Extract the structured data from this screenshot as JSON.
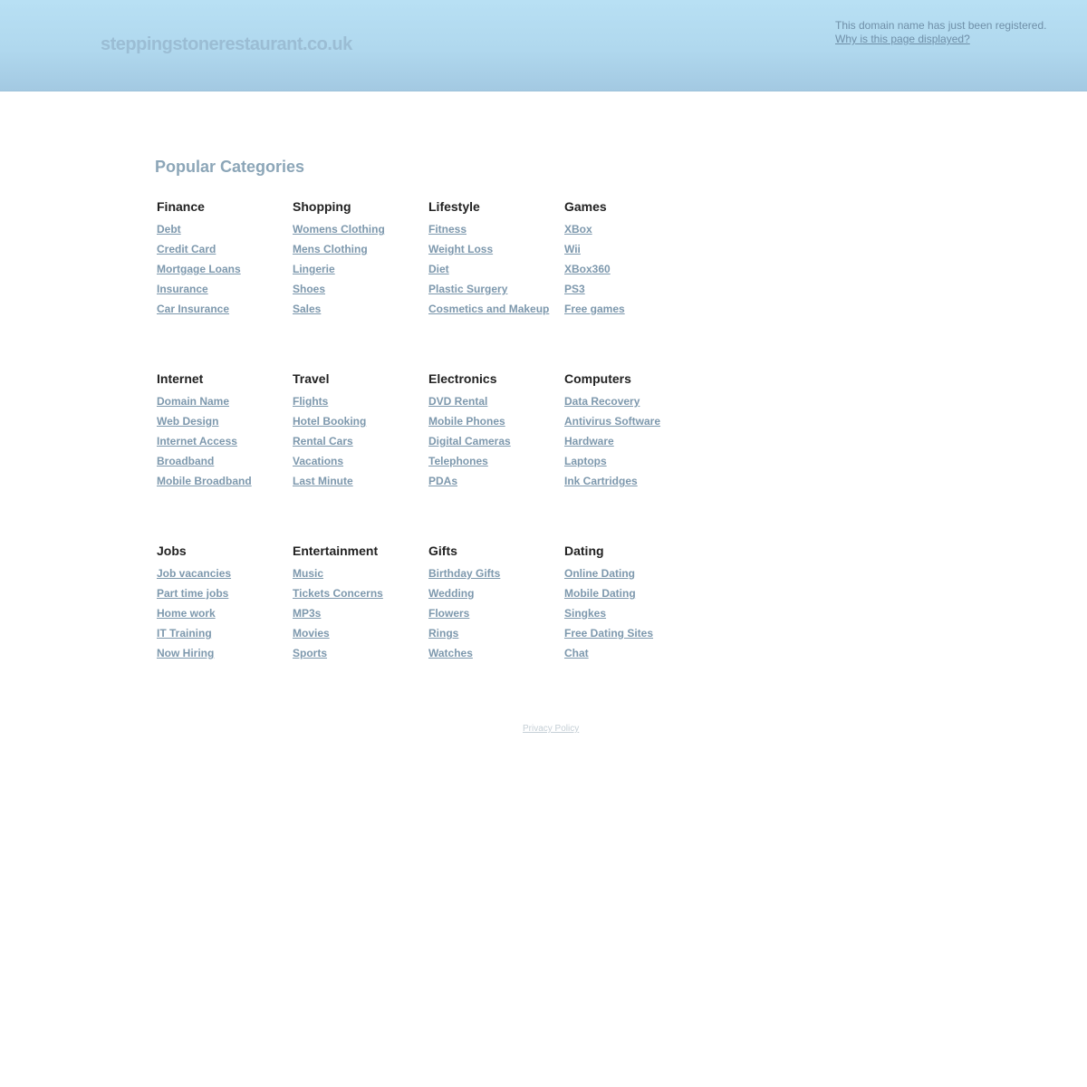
{
  "header": {
    "domain": "steppingstonerestaurant.co.uk",
    "notice": "This domain name has just been registered.",
    "why_link": "Why is this page displayed?"
  },
  "main": {
    "heading": "Popular Categories",
    "rows": [
      [
        {
          "title": "Finance",
          "links": [
            "Debt",
            "Credit Card",
            "Mortgage Loans",
            "Insurance",
            "Car Insurance"
          ]
        },
        {
          "title": "Shopping",
          "links": [
            "Womens Clothing",
            "Mens Clothing",
            "Lingerie",
            "Shoes",
            "Sales"
          ]
        },
        {
          "title": "Lifestyle",
          "links": [
            "Fitness",
            "Weight Loss",
            "Diet",
            "Plastic Surgery",
            "Cosmetics and Makeup"
          ]
        },
        {
          "title": "Games",
          "links": [
            "XBox",
            "Wii",
            "XBox360",
            "PS3",
            "Free games"
          ]
        }
      ],
      [
        {
          "title": "Internet",
          "links": [
            "Domain Name",
            "Web Design",
            "Internet Access",
            "Broadband",
            "Mobile Broadband"
          ]
        },
        {
          "title": "Travel",
          "links": [
            "Flights",
            "Hotel Booking",
            "Rental Cars",
            "Vacations",
            "Last Minute"
          ]
        },
        {
          "title": "Electronics",
          "links": [
            "DVD Rental",
            "Mobile Phones",
            "Digital Cameras",
            "Telephones",
            "PDAs"
          ]
        },
        {
          "title": "Computers",
          "links": [
            "Data Recovery",
            "Antivirus Software",
            "Hardware",
            "Laptops",
            "Ink Cartridges"
          ]
        }
      ],
      [
        {
          "title": "Jobs",
          "links": [
            "Job vacancies",
            "Part time jobs",
            "Home work",
            "IT Training",
            "Now Hiring"
          ]
        },
        {
          "title": "Entertainment",
          "links": [
            "Music",
            "Tickets Concerns",
            "MP3s",
            "Movies",
            "Sports"
          ]
        },
        {
          "title": "Gifts",
          "links": [
            "Birthday Gifts",
            "Wedding",
            "Flowers",
            "Rings",
            "Watches"
          ]
        },
        {
          "title": "Dating",
          "links": [
            "Online Dating",
            "Mobile Dating",
            "Singkes",
            "Free Dating Sites",
            "Chat"
          ]
        }
      ]
    ]
  },
  "footer": {
    "privacy": "Privacy Policy"
  },
  "colors": {
    "header_top": "#b8e0f4",
    "header_bottom": "#a3c9e2",
    "link": "#7d98ad",
    "heading": "#8ca6b8",
    "category_title": "#222222"
  }
}
